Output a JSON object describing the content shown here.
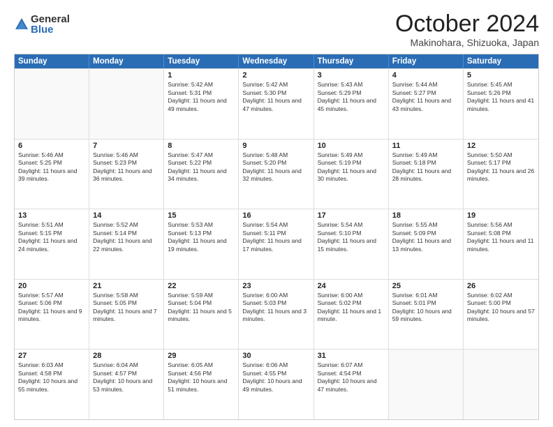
{
  "logo": {
    "general": "General",
    "blue": "Blue"
  },
  "header": {
    "month": "October 2024",
    "location": "Makinohara, Shizuoka, Japan"
  },
  "days": [
    "Sunday",
    "Monday",
    "Tuesday",
    "Wednesday",
    "Thursday",
    "Friday",
    "Saturday"
  ],
  "weeks": [
    [
      {
        "day": "",
        "info": ""
      },
      {
        "day": "",
        "info": ""
      },
      {
        "day": "1",
        "info": "Sunrise: 5:42 AM\nSunset: 5:31 PM\nDaylight: 11 hours and 49 minutes."
      },
      {
        "day": "2",
        "info": "Sunrise: 5:42 AM\nSunset: 5:30 PM\nDaylight: 11 hours and 47 minutes."
      },
      {
        "day": "3",
        "info": "Sunrise: 5:43 AM\nSunset: 5:29 PM\nDaylight: 11 hours and 45 minutes."
      },
      {
        "day": "4",
        "info": "Sunrise: 5:44 AM\nSunset: 5:27 PM\nDaylight: 11 hours and 43 minutes."
      },
      {
        "day": "5",
        "info": "Sunrise: 5:45 AM\nSunset: 5:26 PM\nDaylight: 11 hours and 41 minutes."
      }
    ],
    [
      {
        "day": "6",
        "info": "Sunrise: 5:46 AM\nSunset: 5:25 PM\nDaylight: 11 hours and 39 minutes."
      },
      {
        "day": "7",
        "info": "Sunrise: 5:46 AM\nSunset: 5:23 PM\nDaylight: 11 hours and 36 minutes."
      },
      {
        "day": "8",
        "info": "Sunrise: 5:47 AM\nSunset: 5:22 PM\nDaylight: 11 hours and 34 minutes."
      },
      {
        "day": "9",
        "info": "Sunrise: 5:48 AM\nSunset: 5:20 PM\nDaylight: 11 hours and 32 minutes."
      },
      {
        "day": "10",
        "info": "Sunrise: 5:49 AM\nSunset: 5:19 PM\nDaylight: 11 hours and 30 minutes."
      },
      {
        "day": "11",
        "info": "Sunrise: 5:49 AM\nSunset: 5:18 PM\nDaylight: 11 hours and 28 minutes."
      },
      {
        "day": "12",
        "info": "Sunrise: 5:50 AM\nSunset: 5:17 PM\nDaylight: 11 hours and 26 minutes."
      }
    ],
    [
      {
        "day": "13",
        "info": "Sunrise: 5:51 AM\nSunset: 5:15 PM\nDaylight: 11 hours and 24 minutes."
      },
      {
        "day": "14",
        "info": "Sunrise: 5:52 AM\nSunset: 5:14 PM\nDaylight: 11 hours and 22 minutes."
      },
      {
        "day": "15",
        "info": "Sunrise: 5:53 AM\nSunset: 5:13 PM\nDaylight: 11 hours and 19 minutes."
      },
      {
        "day": "16",
        "info": "Sunrise: 5:54 AM\nSunset: 5:11 PM\nDaylight: 11 hours and 17 minutes."
      },
      {
        "day": "17",
        "info": "Sunrise: 5:54 AM\nSunset: 5:10 PM\nDaylight: 11 hours and 15 minutes."
      },
      {
        "day": "18",
        "info": "Sunrise: 5:55 AM\nSunset: 5:09 PM\nDaylight: 11 hours and 13 minutes."
      },
      {
        "day": "19",
        "info": "Sunrise: 5:56 AM\nSunset: 5:08 PM\nDaylight: 11 hours and 11 minutes."
      }
    ],
    [
      {
        "day": "20",
        "info": "Sunrise: 5:57 AM\nSunset: 5:06 PM\nDaylight: 11 hours and 9 minutes."
      },
      {
        "day": "21",
        "info": "Sunrise: 5:58 AM\nSunset: 5:05 PM\nDaylight: 11 hours and 7 minutes."
      },
      {
        "day": "22",
        "info": "Sunrise: 5:59 AM\nSunset: 5:04 PM\nDaylight: 11 hours and 5 minutes."
      },
      {
        "day": "23",
        "info": "Sunrise: 6:00 AM\nSunset: 5:03 PM\nDaylight: 11 hours and 3 minutes."
      },
      {
        "day": "24",
        "info": "Sunrise: 6:00 AM\nSunset: 5:02 PM\nDaylight: 11 hours and 1 minute."
      },
      {
        "day": "25",
        "info": "Sunrise: 6:01 AM\nSunset: 5:01 PM\nDaylight: 10 hours and 59 minutes."
      },
      {
        "day": "26",
        "info": "Sunrise: 6:02 AM\nSunset: 5:00 PM\nDaylight: 10 hours and 57 minutes."
      }
    ],
    [
      {
        "day": "27",
        "info": "Sunrise: 6:03 AM\nSunset: 4:58 PM\nDaylight: 10 hours and 55 minutes."
      },
      {
        "day": "28",
        "info": "Sunrise: 6:04 AM\nSunset: 4:57 PM\nDaylight: 10 hours and 53 minutes."
      },
      {
        "day": "29",
        "info": "Sunrise: 6:05 AM\nSunset: 4:56 PM\nDaylight: 10 hours and 51 minutes."
      },
      {
        "day": "30",
        "info": "Sunrise: 6:06 AM\nSunset: 4:55 PM\nDaylight: 10 hours and 49 minutes."
      },
      {
        "day": "31",
        "info": "Sunrise: 6:07 AM\nSunset: 4:54 PM\nDaylight: 10 hours and 47 minutes."
      },
      {
        "day": "",
        "info": ""
      },
      {
        "day": "",
        "info": ""
      }
    ]
  ]
}
